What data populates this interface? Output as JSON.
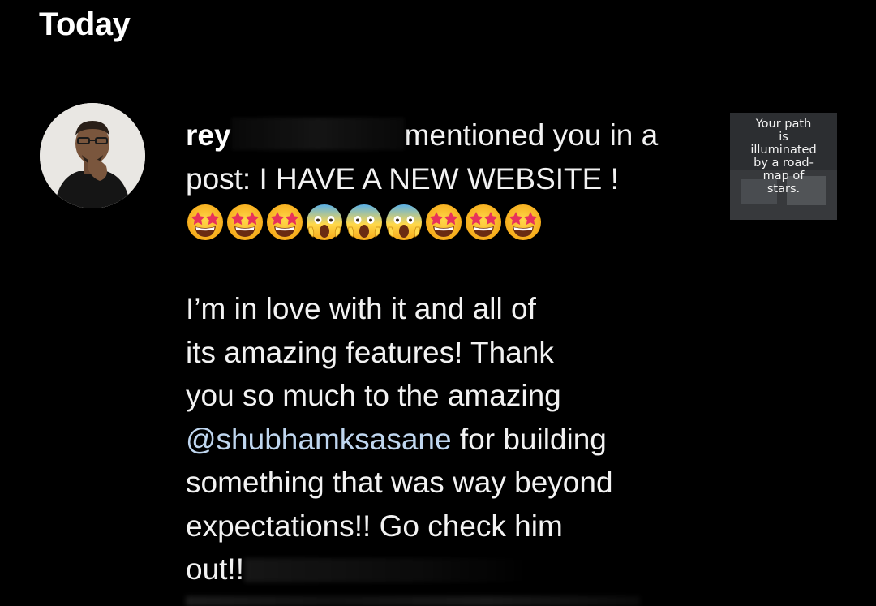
{
  "section": {
    "title": "Today"
  },
  "notification": {
    "username": "rey",
    "action": "mentioned you in a post: I HAVE A NEW WEBSITE !",
    "emojis": [
      "star-struck-icon",
      "star-struck-icon",
      "star-struck-icon",
      "screaming-in-fear-icon",
      "screaming-in-fear-icon",
      "screaming-in-fear-icon",
      "star-struck-icon",
      "star-struck-icon",
      "star-struck-icon"
    ],
    "body_line_1": "I’m in love with it and all of",
    "body_line_2": "its amazing features! Thank",
    "body_line_3": "you so much to the amazing",
    "mention": "@shubhamksasane",
    "body_after_mention": " for building",
    "body_line_5": "something that was way beyond",
    "body_line_6": "expectations!! Go check him",
    "body_line_7": "out!!"
  },
  "thumbnail": {
    "text": "Your path\nis\nilluminated\nby a road-\nmap of\nstars."
  },
  "colors": {
    "background": "#000000",
    "text": "#f2f2f2",
    "mention": "#bfd6ef",
    "emoji_face": "#ffc928",
    "emoji_fear_face": "#6fb6e4"
  }
}
